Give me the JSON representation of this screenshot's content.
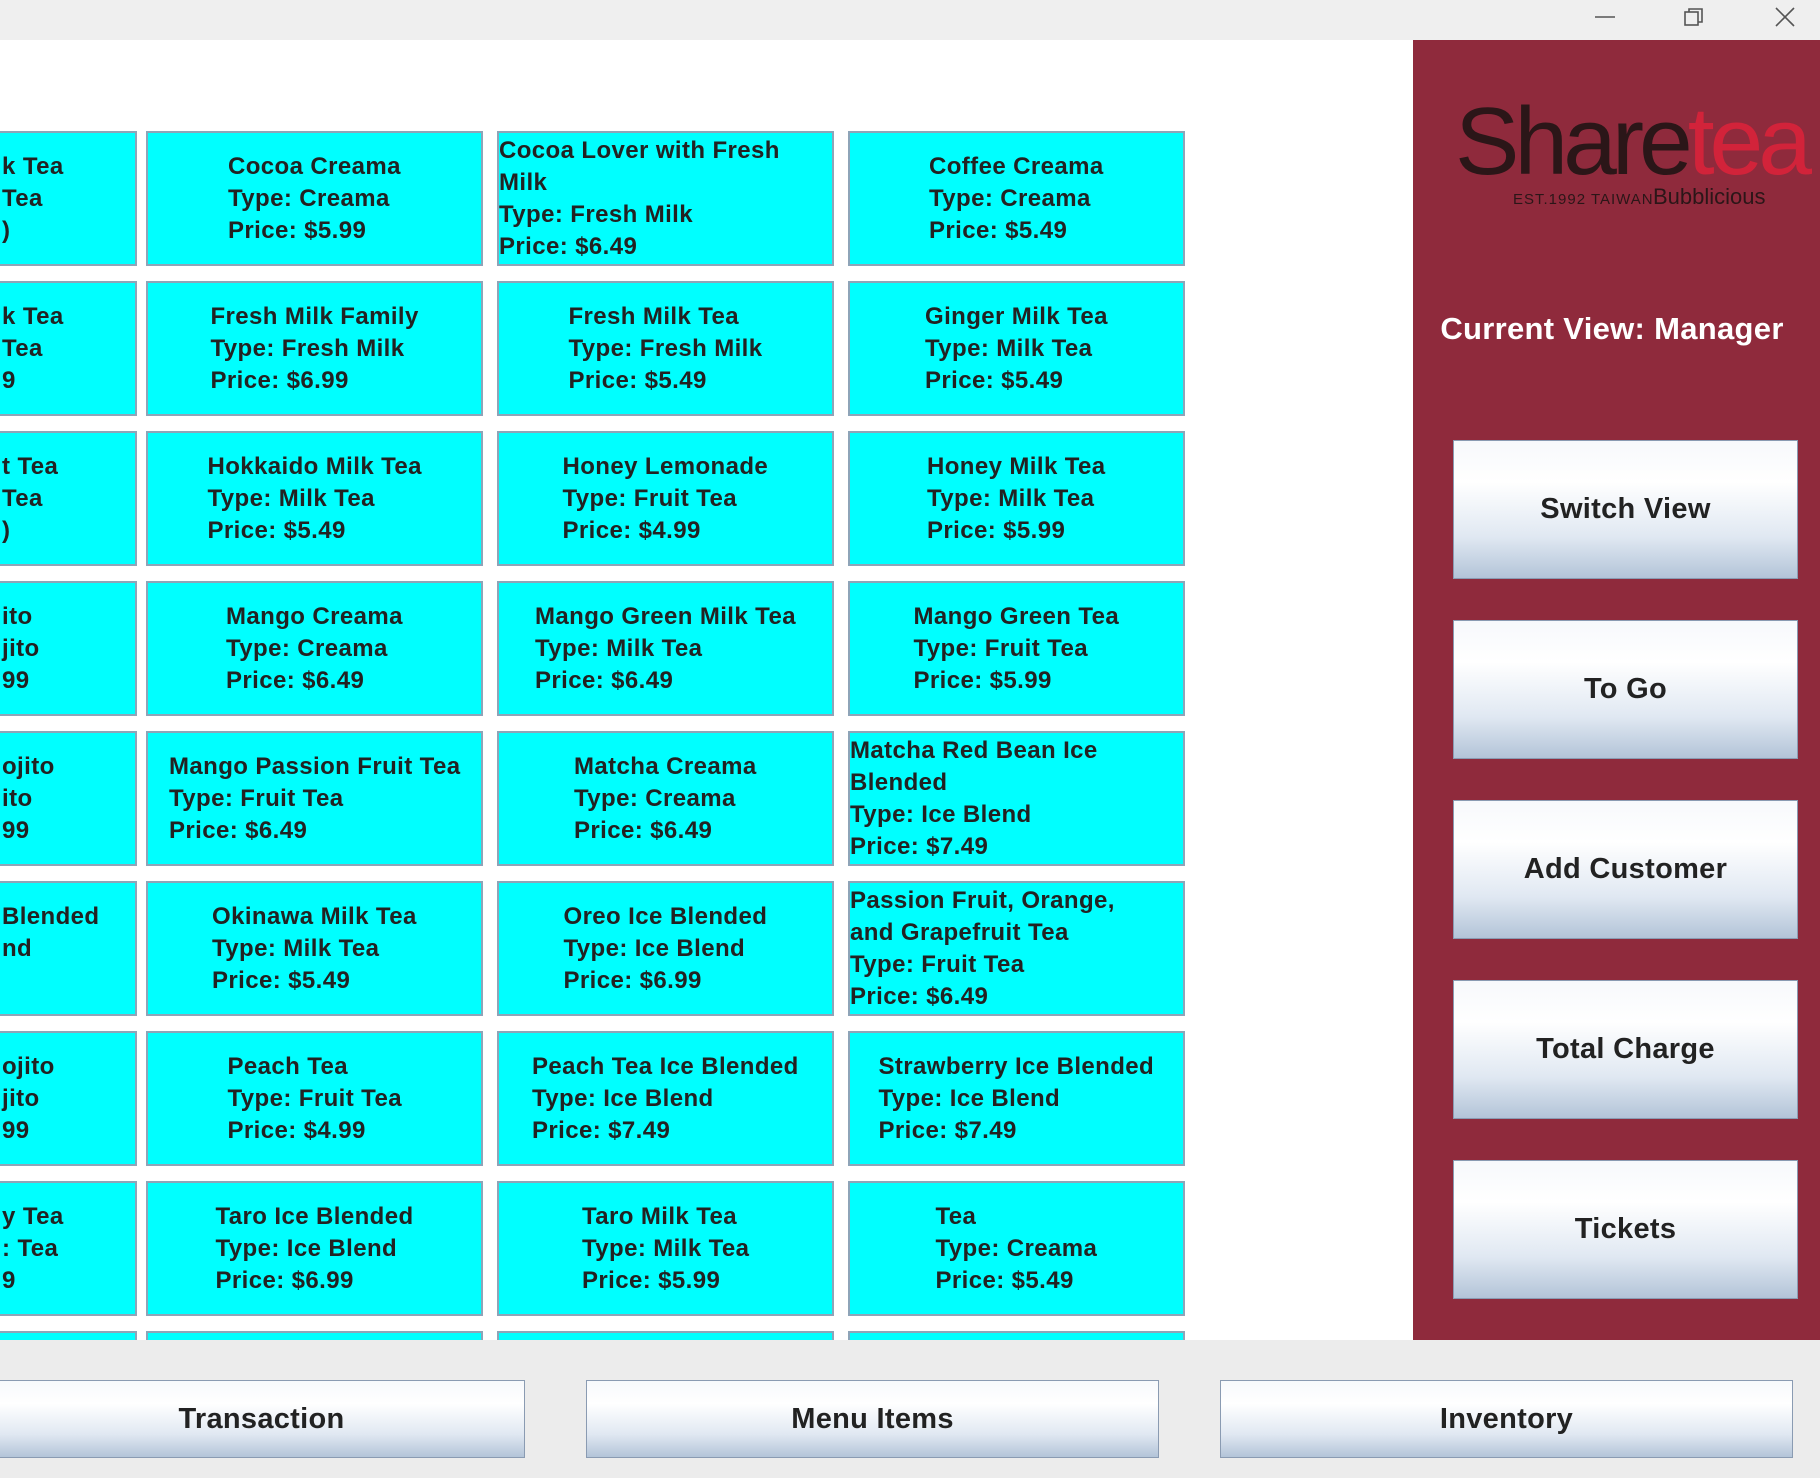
{
  "menu_tiles": {
    "c0": [
      {
        "l1": "k Tea",
        "l2": "Tea",
        "l3": ")"
      },
      {
        "l1": "k Tea",
        "l2": "Tea",
        "l3": "9"
      },
      {
        "l1": "t Tea",
        "l2": " Tea",
        "l3": ")"
      },
      {
        "l1": "ito",
        "l2": "jito",
        "l3": "99"
      },
      {
        "l1": "ojito",
        "l2": "ito",
        "l3": "99"
      },
      {
        "l1": "Blended",
        "l2": "nd",
        "l3": ""
      },
      {
        "l1": "ojito",
        "l2": "jito",
        "l3": "99"
      },
      {
        "l1": "y Tea",
        "l2": ": Tea",
        "l3": "9"
      }
    ],
    "c1": [
      {
        "name": "Cocoa Creama",
        "type": "Type: Creama",
        "price": "Price: $5.99"
      },
      {
        "name": "Fresh Milk Family",
        "type": "Type: Fresh Milk",
        "price": "Price: $6.99"
      },
      {
        "name": "Hokkaido Milk Tea",
        "type": "Type: Milk Tea",
        "price": "Price: $5.49"
      },
      {
        "name": "Mango Creama",
        "type": "Type: Creama",
        "price": "Price: $6.49"
      },
      {
        "name": "Mango Passion Fruit Tea",
        "type": "Type: Fruit Tea",
        "price": "Price: $6.49"
      },
      {
        "name": "Okinawa Milk Tea",
        "type": "Type: Milk Tea",
        "price": "Price: $5.49"
      },
      {
        "name": "Peach Tea",
        "type": "Type: Fruit Tea",
        "price": "Price: $4.99"
      },
      {
        "name": "Taro Ice Blended",
        "type": "Type: Ice Blend",
        "price": "Price: $6.99"
      }
    ],
    "c2": [
      {
        "name": "Cocoa Lover with Fresh Milk",
        "type": "Type: Fresh Milk",
        "price": "Price: $6.49"
      },
      {
        "name": "Fresh Milk Tea",
        "type": "Type: Fresh Milk",
        "price": "Price: $5.49"
      },
      {
        "name": "Honey Lemonade",
        "type": "Type: Fruit Tea",
        "price": "Price: $4.99"
      },
      {
        "name": "Mango Green Milk Tea",
        "type": "Type: Milk Tea",
        "price": "Price: $6.49"
      },
      {
        "name": "Matcha Creama",
        "type": "Type: Creama",
        "price": "Price: $6.49"
      },
      {
        "name": "Oreo Ice Blended",
        "type": "Type: Ice Blend",
        "price": "Price: $6.99"
      },
      {
        "name": "Peach Tea Ice Blended",
        "type": "Type: Ice Blend",
        "price": "Price: $7.49"
      },
      {
        "name": "Taro Milk Tea",
        "type": "Type: Milk Tea",
        "price": "Price: $5.99"
      }
    ],
    "c3": [
      {
        "name": "Coffee Creama",
        "type": "Type: Creama",
        "price": "Price: $5.49"
      },
      {
        "name": "Ginger Milk Tea",
        "type": "Type: Milk Tea",
        "price": "Price: $5.49"
      },
      {
        "name": "Honey Milk Tea",
        "type": "Type: Milk Tea",
        "price": "Price: $5.99"
      },
      {
        "name": "Mango Green Tea",
        "type": "Type: Fruit Tea",
        "price": "Price: $5.99"
      },
      {
        "name": "Matcha Red Bean Ice Blended",
        "type": "Type: Ice Blend",
        "price": "Price: $7.49"
      },
      {
        "name": "Passion Fruit, Orange, and Grapefruit Tea",
        "type": "Type: Fruit Tea",
        "price": "Price: $6.49"
      },
      {
        "name": "Strawberry Ice Blended",
        "type": "Type: Ice Blend",
        "price": "Price: $7.49"
      },
      {
        "name": "Tea",
        "type": "Type: Creama",
        "price": "Price: $5.49"
      }
    ]
  },
  "sidebar": {
    "logo_brand": "Sharetea",
    "logo_share": "Share",
    "logo_tea": "tea",
    "logo_est": "EST.1992 TAIWAN",
    "logo_tagline": "Bubblicious",
    "current_view": "Current View: Manager",
    "buttons": {
      "switch_view": "Switch View",
      "to_go": "To Go",
      "add_customer": "Add Customer",
      "total_charge": "Total Charge",
      "tickets": "Tickets"
    }
  },
  "bottom_nav": {
    "transaction": "Transaction",
    "menu_items": "Menu Items",
    "inventory": "Inventory"
  },
  "colors": {
    "tile_bg": "#00ffff",
    "sidebar_bg": "#8f2a3c",
    "logo_dark": "#2b1618",
    "logo_red": "#d2233a"
  },
  "icons": {
    "minimize": "minimize-icon",
    "restore": "restore-icon",
    "close": "close-icon"
  }
}
